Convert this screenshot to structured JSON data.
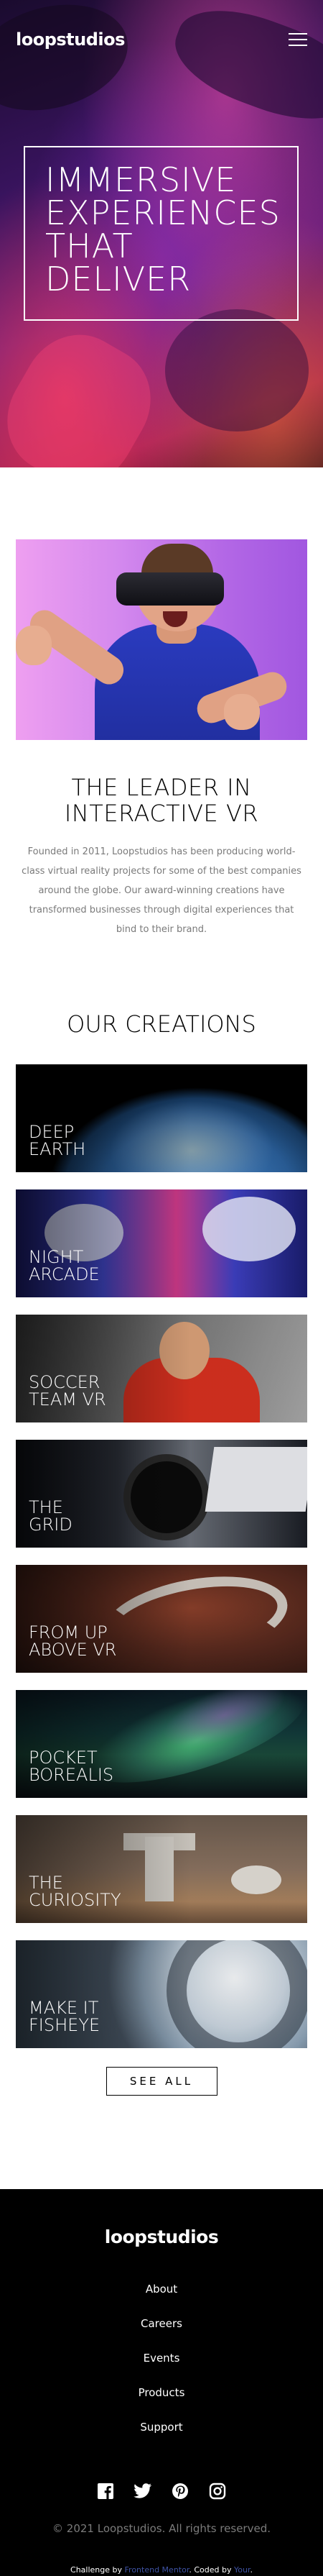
{
  "header": {
    "logo": "loopstudios",
    "menu_icon": "hamburger-menu-icon"
  },
  "hero": {
    "title": "Immersive experiences that deliver"
  },
  "intro": {
    "image_alt": "Man wearing a VR headset",
    "title": "The leader in interactive VR",
    "text": "Founded in 2011, Loopstudios has been producing world-class virtual reality projects for some of the best companies around the globe. Our award-winning creations have transformed businesses through digital experiences that bind to their brand."
  },
  "creations": {
    "title": "Our creations",
    "items": [
      {
        "label": "Deep\nEarth"
      },
      {
        "label": "Night\nArcade"
      },
      {
        "label": "Soccer\nTeam VR"
      },
      {
        "label": "The\nGrid"
      },
      {
        "label": "From up\nabove VR"
      },
      {
        "label": "Pocket\nBorealis"
      },
      {
        "label": "The\nCuriosity"
      },
      {
        "label": "Make it\nFisheye"
      }
    ],
    "see_all": "See all"
  },
  "footer": {
    "logo": "loopstudios",
    "nav": [
      "About",
      "Careers",
      "Events",
      "Products",
      "Support"
    ],
    "socials": [
      "facebook-icon",
      "twitter-icon",
      "pinterest-icon",
      "instagram-icon"
    ],
    "copyright": "© 2021 Loopstudios. All rights reserved.",
    "attribution": {
      "prefix": "Challenge by",
      "challenge_link": "Frontend Mentor",
      "middle": ". Coded by",
      "coder_link": "Your",
      "suffix": "."
    }
  },
  "colors": {
    "footer_bg": "#000000",
    "link_accent": "#3e52a3",
    "muted_text": "#7a7a7a"
  }
}
